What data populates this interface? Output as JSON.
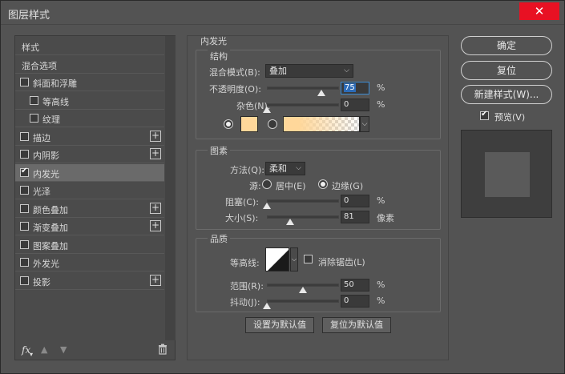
{
  "window": {
    "title": "图层样式"
  },
  "left_list": {
    "items": [
      {
        "label": "样式",
        "checkbox": false,
        "checked": false,
        "plus": false,
        "indent": 0
      },
      {
        "label": "混合选项",
        "checkbox": false,
        "checked": false,
        "plus": false,
        "indent": 0
      },
      {
        "label": "斜面和浮雕",
        "checkbox": true,
        "checked": false,
        "plus": false,
        "indent": 0
      },
      {
        "label": "等高线",
        "checkbox": true,
        "checked": false,
        "plus": false,
        "indent": 1
      },
      {
        "label": "纹理",
        "checkbox": true,
        "checked": false,
        "plus": false,
        "indent": 1
      },
      {
        "label": "描边",
        "checkbox": true,
        "checked": false,
        "plus": true,
        "indent": 0
      },
      {
        "label": "内阴影",
        "checkbox": true,
        "checked": false,
        "plus": true,
        "indent": 0
      },
      {
        "label": "内发光",
        "checkbox": true,
        "checked": true,
        "plus": false,
        "indent": 0,
        "selected": true
      },
      {
        "label": "光泽",
        "checkbox": true,
        "checked": false,
        "plus": false,
        "indent": 0
      },
      {
        "label": "颜色叠加",
        "checkbox": true,
        "checked": false,
        "plus": true,
        "indent": 0
      },
      {
        "label": "渐变叠加",
        "checkbox": true,
        "checked": false,
        "plus": true,
        "indent": 0
      },
      {
        "label": "图案叠加",
        "checkbox": true,
        "checked": false,
        "plus": false,
        "indent": 0
      },
      {
        "label": "外发光",
        "checkbox": true,
        "checked": false,
        "plus": false,
        "indent": 0
      },
      {
        "label": "投影",
        "checkbox": true,
        "checked": false,
        "plus": true,
        "indent": 0
      }
    ],
    "footer": {
      "fx": "fx",
      "up_icon": "arrow-up-icon",
      "down_icon": "arrow-down-icon",
      "trash_icon": "trash-icon"
    }
  },
  "main": {
    "heading": "内发光",
    "structure": {
      "title": "结构",
      "blend_mode_label": "混合模式(B):",
      "blend_mode_value": "叠加",
      "opacity_label": "不透明度(O):",
      "opacity_value": "75",
      "opacity_unit": "%",
      "opacity_level": 0.75,
      "noise_label": "杂色(N):",
      "noise_value": "0",
      "noise_unit": "%",
      "noise_level": 0,
      "color_swatch": "#ffd79a"
    },
    "elements": {
      "title": "图素",
      "method_label": "方法(Q):",
      "method_value": "柔和",
      "source_label": "源:",
      "source_center": "居中(E)",
      "source_edge": "边缘(G)",
      "choke_label": "阻塞(C):",
      "choke_value": "0",
      "choke_unit": "%",
      "choke_level": 0,
      "size_label": "大小(S):",
      "size_value": "81",
      "size_unit": "像素",
      "size_level": 0.32
    },
    "quality": {
      "title": "品质",
      "contour_label": "等高线:",
      "antialias_label": "消除锯齿(L)",
      "range_label": "范围(R):",
      "range_value": "50",
      "range_unit": "%",
      "range_level": 0.5,
      "jitter_label": "抖动(J):",
      "jitter_value": "0",
      "jitter_unit": "%",
      "jitter_level": 0
    },
    "buttons": {
      "make_default": "设置为默认值",
      "reset_default": "复位为默认值"
    }
  },
  "right": {
    "ok": "确定",
    "reset": "复位",
    "new_style": "新建样式(W)...",
    "preview_label": "预览(V)",
    "preview_checked": true
  },
  "colors": {
    "dialog_bg": "#535353",
    "close_red": "#e81123",
    "glow_color": "#ffd79a",
    "highlight_blue": "#2d6cb8"
  }
}
